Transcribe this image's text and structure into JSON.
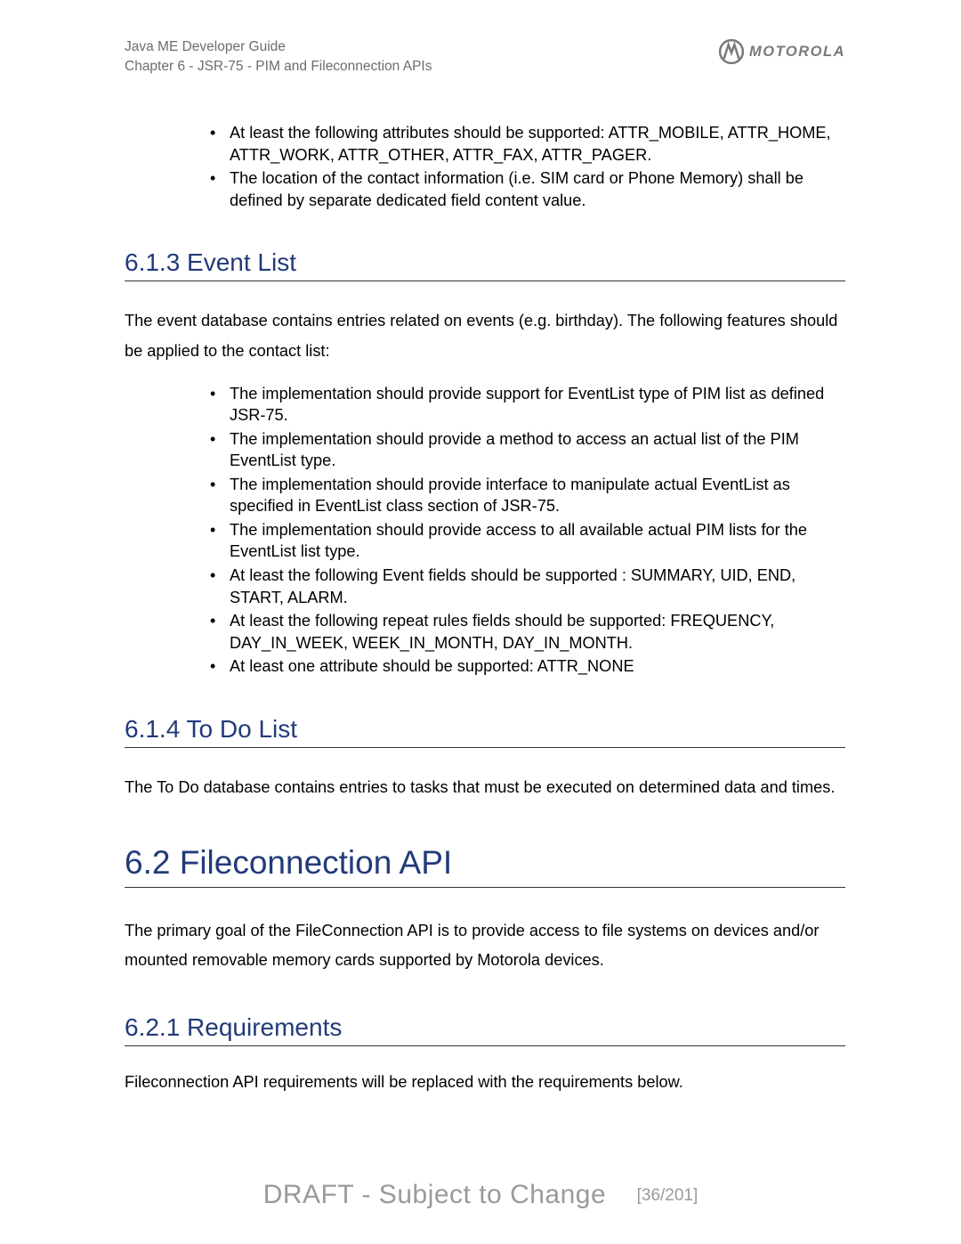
{
  "header": {
    "line1": "Java ME Developer Guide",
    "line2": "Chapter 6 - JSR-75 - PIM and Fileconnection APIs",
    "brand": "MOTOROLA"
  },
  "topBullets": [
    "At least the following attributes should be supported: ATTR_MOBILE, ATTR_HOME, ATTR_WORK, ATTR_OTHER, ATTR_FAX, ATTR_PAGER.",
    "The location of the contact information (i.e. SIM card or Phone Memory) shall be defined by separate dedicated field content value."
  ],
  "sections": {
    "eventList": {
      "heading": "6.1.3 Event List",
      "intro": "The event database contains entries related on events (e.g. birthday). The following features should be applied to the contact list:",
      "bullets": [
        "The implementation should provide support for EventList type of PIM list as defined JSR-75.",
        "The implementation should provide a method to access an actual list of the PIM EventList type.",
        "The implementation should provide interface to manipulate actual EventList as specified in EventList class section of JSR-75.",
        "The implementation should provide access to all available actual PIM lists for the EventList list type.",
        "At least the following Event fields should be supported : SUMMARY, UID, END, START, ALARM.",
        "At least the following repeat rules fields should be supported: FREQUENCY, DAY_IN_WEEK, WEEK_IN_MONTH, DAY_IN_MONTH.",
        "At least one attribute should be supported: ATTR_NONE"
      ]
    },
    "todoList": {
      "heading": "6.1.4 To Do List",
      "intro": "The To Do database contains entries to tasks that must be executed on determined data and times."
    },
    "fileconn": {
      "heading": "6.2 Fileconnection API",
      "intro": "The primary goal of the FileConnection API is to provide access to file systems on devices and/or mounted removable memory cards supported by Motorola devices."
    },
    "requirements": {
      "heading": "6.2.1 Requirements",
      "intro": "Fileconnection API requirements will be replaced with the requirements below."
    }
  },
  "footer": {
    "draft": "DRAFT - Subject to Change",
    "page": "[36/201]"
  }
}
